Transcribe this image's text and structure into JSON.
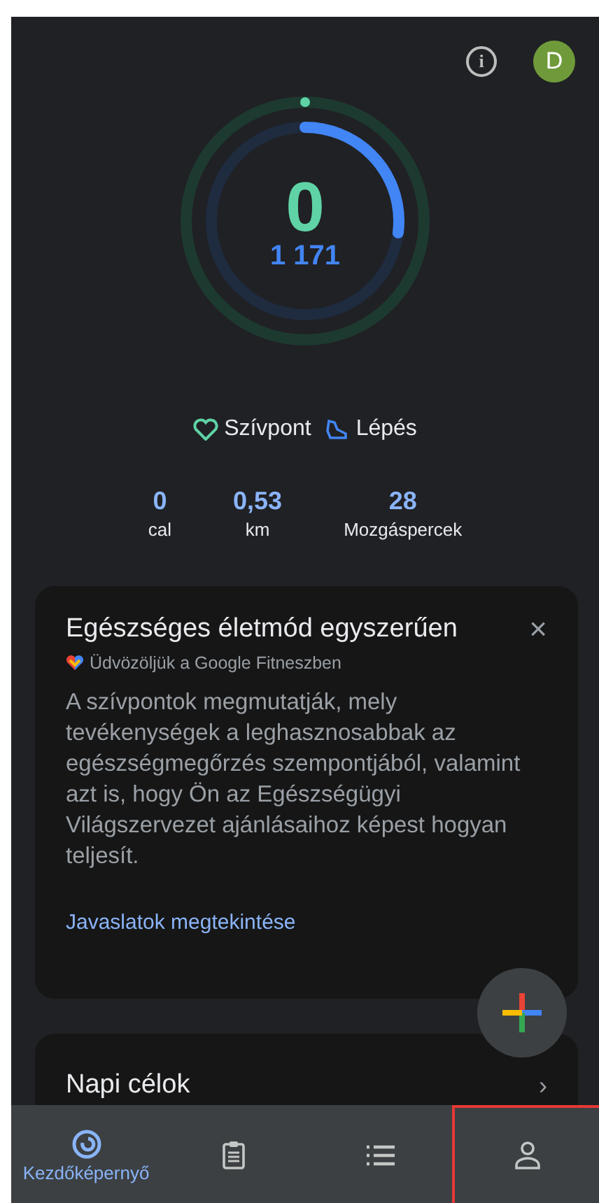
{
  "header": {
    "info_label": "i",
    "avatar_letter": "D"
  },
  "rings": {
    "heart_points": {
      "value": "0"
    },
    "steps": {
      "value": "1 171"
    }
  },
  "legend": [
    {
      "kind": "heart",
      "label": "Szívpont"
    },
    {
      "kind": "steps",
      "label": "Lépés"
    }
  ],
  "stats": [
    {
      "value": "0",
      "unit": "cal"
    },
    {
      "value": "0,53",
      "unit": "km"
    },
    {
      "value": "28",
      "unit": "Mozgáspercek"
    }
  ],
  "welcome_card": {
    "title": "Egészséges életmód egyszerűen",
    "subtitle": "Üdvözöljük a Google Fitneszben",
    "body": "A szívpontok megmutatják, mely tevékenységek a leghasznosabbak az egészségmegőrzés szempontjából, valamint azt is, hogy Ön az Egészségügyi Világszervezet ajánlásaihoz képest hogyan teljesít.",
    "link": "Javaslatok megtekintése",
    "close": "×"
  },
  "goals_card": {
    "title": "Napi célok",
    "chevron": "›"
  },
  "nav": [
    {
      "kind": "home",
      "label": "Kezdőképernyő",
      "selected": true,
      "highlighted": false
    },
    {
      "kind": "journal",
      "selected": false,
      "highlighted": false
    },
    {
      "kind": "browse",
      "selected": false,
      "highlighted": false
    },
    {
      "kind": "profile",
      "selected": false,
      "highlighted": true
    }
  ]
}
